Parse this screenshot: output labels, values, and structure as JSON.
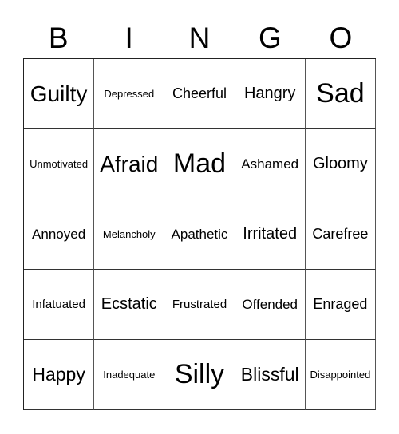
{
  "header": [
    "B",
    "I",
    "N",
    "G",
    "O"
  ],
  "cells": [
    [
      "Guilty",
      "Depressed",
      "Cheerful",
      "Hangry",
      "Sad"
    ],
    [
      "Unmotivated",
      "Afraid",
      "Mad",
      "Ashamed",
      "Gloomy"
    ],
    [
      "Annoyed",
      "Melancholy",
      "Apathetic",
      "Irritated",
      "Carefree"
    ],
    [
      "Infatuated",
      "Ecstatic",
      "Frustrated",
      "Offended",
      "Enraged"
    ],
    [
      "Happy",
      "Inadequate",
      "Silly",
      "Blissful",
      "Disappointed"
    ]
  ]
}
